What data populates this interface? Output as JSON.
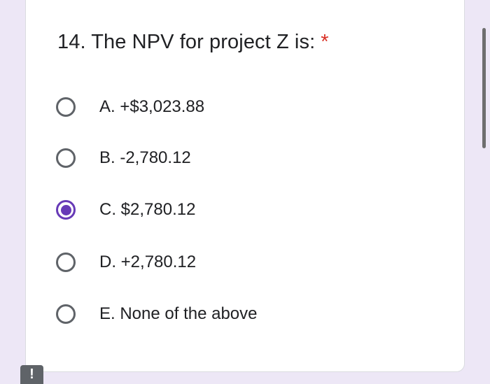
{
  "question": {
    "title": "14. The NPV for project Z is:",
    "required_marker": "*",
    "options": [
      {
        "label": "A. +$3,023.88",
        "selected": false
      },
      {
        "label": "B. -2,780.12",
        "selected": false
      },
      {
        "label": "C. $2,780.12",
        "selected": true
      },
      {
        "label": "D. +2,780.12",
        "selected": false
      },
      {
        "label": "E. None of the above",
        "selected": false
      }
    ]
  },
  "alert_badge": {
    "text": "!"
  },
  "colors": {
    "background": "#ede7f6",
    "accent": "#673ab7",
    "required": "#d93025",
    "text": "#202124",
    "radio_border": "#5f6368"
  }
}
